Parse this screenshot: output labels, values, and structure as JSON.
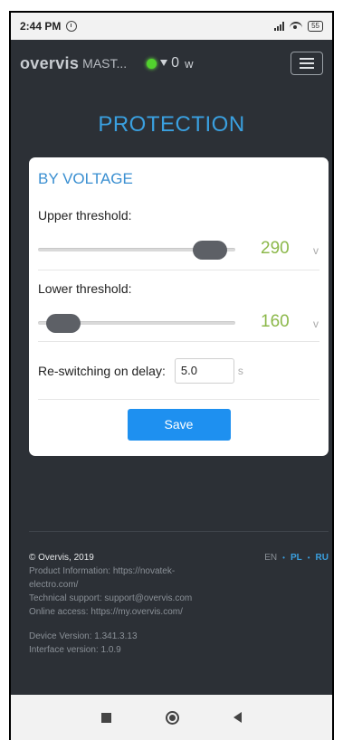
{
  "status_bar": {
    "time": "2:44 PM",
    "battery": "55"
  },
  "header": {
    "brand": "overvis",
    "device": "MAST...",
    "power_value": "0",
    "power_unit": "w",
    "led_color": "#52d12e"
  },
  "page": {
    "title": "PROTECTION"
  },
  "card": {
    "title": "BY VOLTAGE",
    "upper": {
      "label": "Upper threshold:",
      "value": "290",
      "unit": "v",
      "fraction": 0.95
    },
    "lower": {
      "label": "Lower threshold:",
      "value": "160",
      "unit": "v",
      "fraction": 0.05
    },
    "delay": {
      "label": "Re-switching on delay:",
      "value": "5.0",
      "unit": "s"
    },
    "save_label": "Save"
  },
  "footer": {
    "copyright": "© Overvis, 2019",
    "product_info": "Product Information: https://novatek-electro.com/",
    "support": "Technical support: support@overvis.com",
    "online": "Online access: https://my.overvis.com/",
    "device_version": "Device Version: 1.341.3.13",
    "interface_version": "Interface version: 1.0.9",
    "languages": [
      {
        "code": "EN",
        "active": false
      },
      {
        "code": "PL",
        "active": true
      },
      {
        "code": "RU",
        "active": true
      }
    ]
  },
  "colors": {
    "accent": "#3aa0e0",
    "value_green": "#8cb84a",
    "button_blue": "#1e90f0",
    "background_dark": "#2c3036"
  },
  "icons": {
    "alarm": "alarm-icon",
    "signal": "signal-icon",
    "wifi": "wifi-icon",
    "battery": "battery-icon",
    "menu": "hamburger-menu-icon",
    "nav_recents": "square-icon",
    "nav_home": "circle-icon",
    "nav_back": "triangle-back-icon"
  }
}
